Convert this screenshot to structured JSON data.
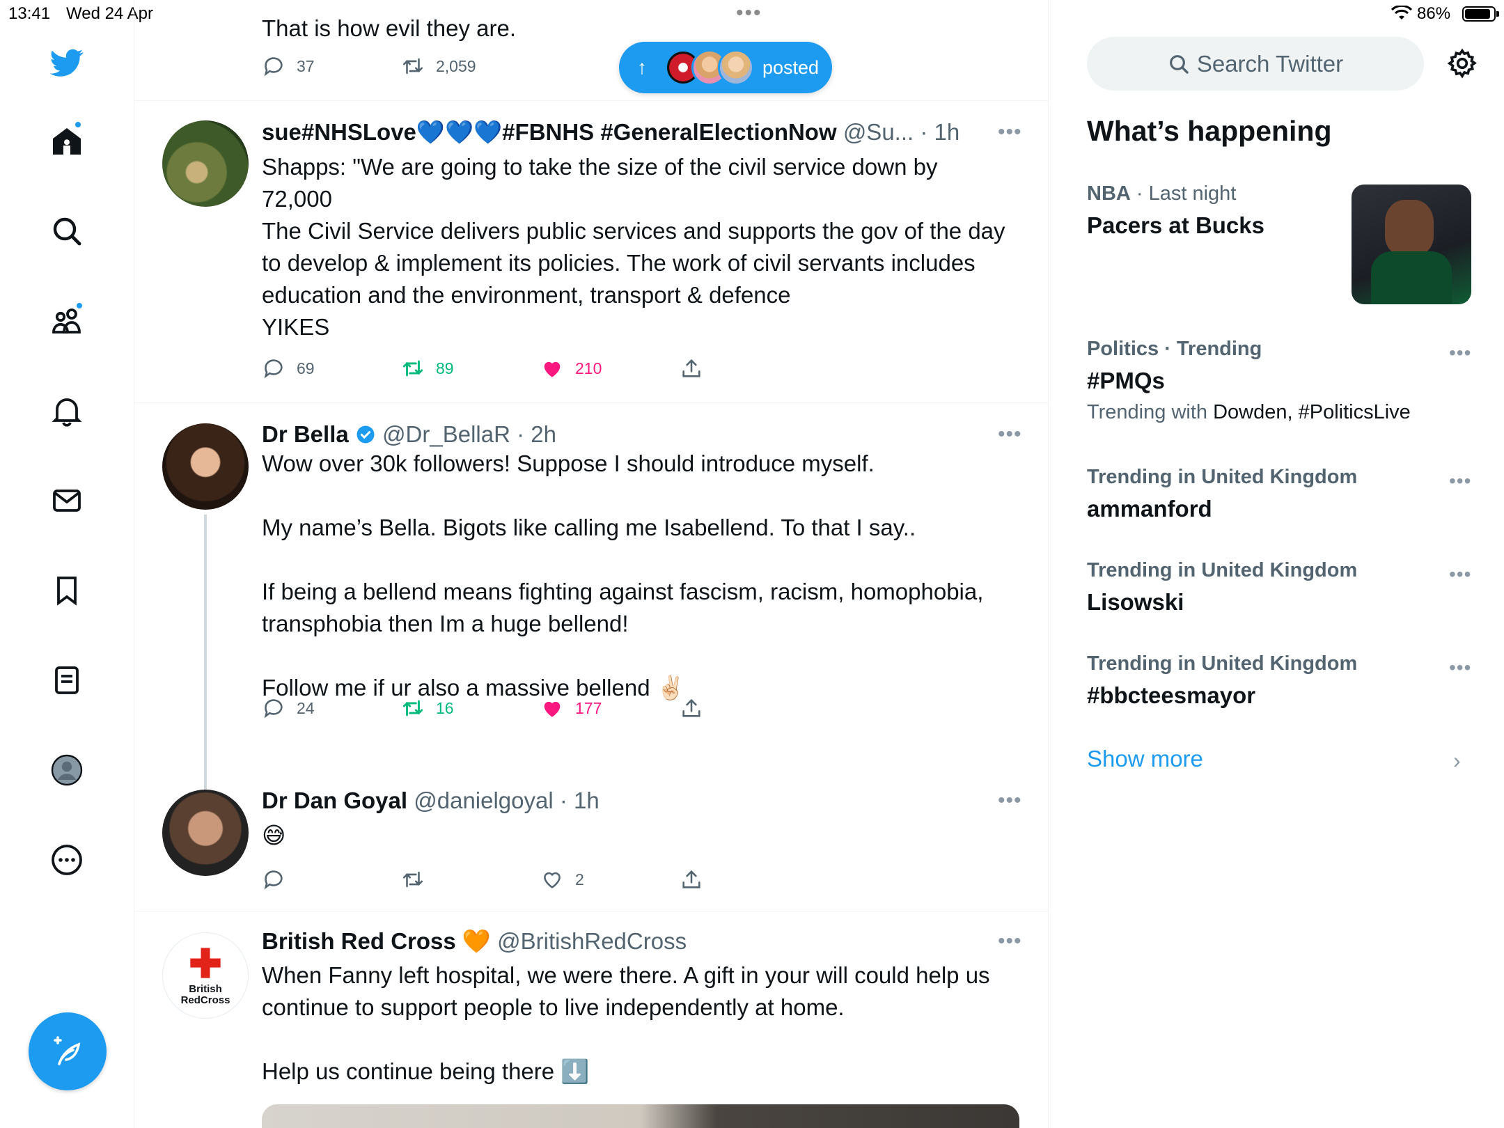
{
  "status_bar": {
    "time": "13:41",
    "date": "Wed 24 Apr",
    "battery_pct": "86%",
    "battery_level": 0.86
  },
  "colors": {
    "accent": "#1d9bf0",
    "retweet": "#00ba7c",
    "like": "#f91880",
    "muted": "#536471"
  },
  "sidebar": {
    "items": [
      {
        "icon": "twitter-logo-icon"
      },
      {
        "icon": "home-icon",
        "has_dot": true
      },
      {
        "icon": "search-icon"
      },
      {
        "icon": "communities-icon",
        "has_dot": true
      },
      {
        "icon": "bell-icon"
      },
      {
        "icon": "mail-icon"
      },
      {
        "icon": "bookmark-icon"
      },
      {
        "icon": "lists-icon"
      },
      {
        "icon": "profile-avatar-icon"
      },
      {
        "icon": "more-circle-icon"
      }
    ],
    "compose_icon": "compose-feather-icon"
  },
  "new_posts_pill": {
    "label": "posted"
  },
  "timeline": {
    "partial_tweet": {
      "text": "That is how evil they are.",
      "replies": "37",
      "retweets": "2,059"
    },
    "tweets": [
      {
        "name": "sue#NHSLove💙💙💙#FBNHS #GeneralElectionNow",
        "handle": "@Su... · 1h",
        "text": "Shapps: \"We are going to take the size of the civil service down by 72,000\nThe Civil Service delivers public services and supports the gov of the day to develop & implement its policies. The work of civil servants includes education and the environment, transport & defence\nYIKES",
        "replies": "69",
        "retweets": "89",
        "likes": "210"
      },
      {
        "name": "Dr Bella",
        "handle": "@Dr_BellaR · 2h",
        "verified": true,
        "text": "Wow over 30k followers! Suppose I should introduce myself.\n\nMy name’s Bella. Bigots like calling me Isabellend. To that I say..\n\nIf being a bellend means fighting against fascism, racism, homophobia, transphobia then Im a huge bellend!\n\nFollow me if ur also a massive bellend ✌🏻",
        "replies": "24",
        "retweets": "16",
        "likes": "177"
      },
      {
        "name": "Dr Dan Goyal",
        "handle": "@danielgoyal · 1h",
        "text": "😅",
        "replies": "",
        "retweets": "",
        "likes": "2"
      },
      {
        "name": "British Red Cross 🧡",
        "handle": "@BritishRedCross",
        "avatar_text_1": "British",
        "avatar_text_2": "RedCross",
        "text": "When Fanny left hospital, we were there. A gift in your will could help us continue to support people to live independently at home.\n\nHelp us continue being there ⬇️"
      }
    ]
  },
  "right_column": {
    "search_placeholder": "Search Twitter",
    "section_title": "What’s happening",
    "trends": [
      {
        "category": "NBA",
        "meta_rest": " · Last night",
        "title": "Pacers at Bucks"
      },
      {
        "category": "Politics · Trending",
        "title": "#PMQs",
        "sub_prefix": "Trending with ",
        "sub_tags": "Dowden, #PoliticsLive"
      },
      {
        "category": "Trending in United Kingdom",
        "title": "ammanford"
      },
      {
        "category": "Trending in United Kingdom",
        "title": "Lisowski"
      },
      {
        "category": "Trending in United Kingdom",
        "title": "#bbcteesmayor"
      }
    ],
    "show_more": "Show more"
  }
}
